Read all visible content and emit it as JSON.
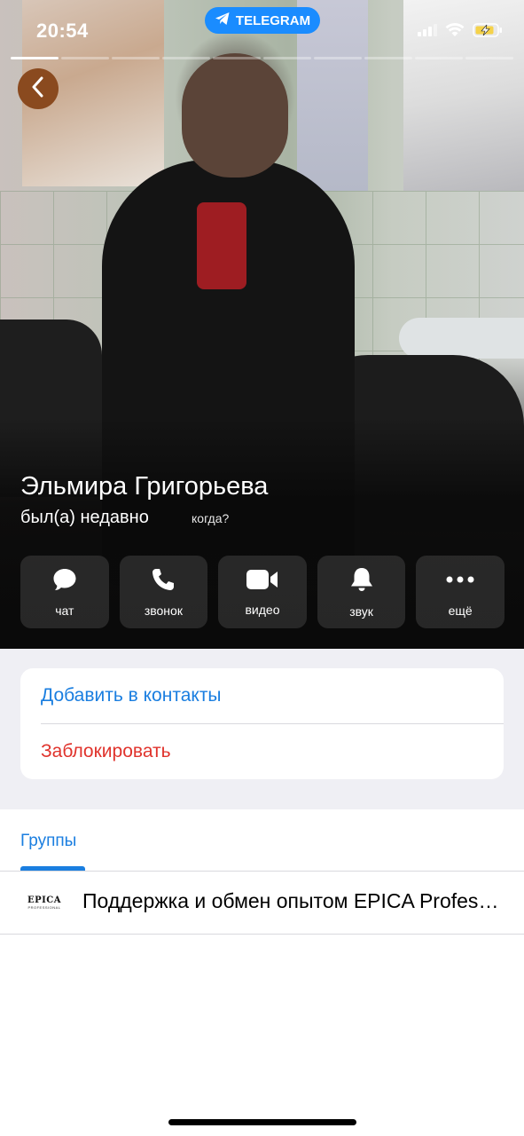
{
  "status_bar": {
    "time": "20:54",
    "app_pill": "TELEGRAM",
    "icons": [
      "signal-icon",
      "wifi-icon",
      "battery-charging-icon"
    ]
  },
  "profile": {
    "name": "Эльмира Григорьева",
    "last_seen": "был(а) недавно",
    "when_link": "когда?"
  },
  "actions": [
    {
      "label": "чат",
      "icon": "chat-bubble-icon"
    },
    {
      "label": "звонок",
      "icon": "phone-icon"
    },
    {
      "label": "видео",
      "icon": "video-camera-icon"
    },
    {
      "label": "звук",
      "icon": "bell-icon"
    },
    {
      "label": "ещё",
      "icon": "more-dots-icon"
    }
  ],
  "contact_card": {
    "add_contact": "Добавить в контакты",
    "block": "Заблокировать"
  },
  "tabs": {
    "groups": "Группы"
  },
  "groups": [
    {
      "title": "Поддержка и обмен опытом EPICA Professional",
      "logo_text": "EPICA",
      "logo_sub": "PROFESSIONAL"
    }
  ],
  "colors": {
    "accent": "#1a7ee0",
    "destructive": "#e0332c",
    "pill": "#1a8cff"
  }
}
